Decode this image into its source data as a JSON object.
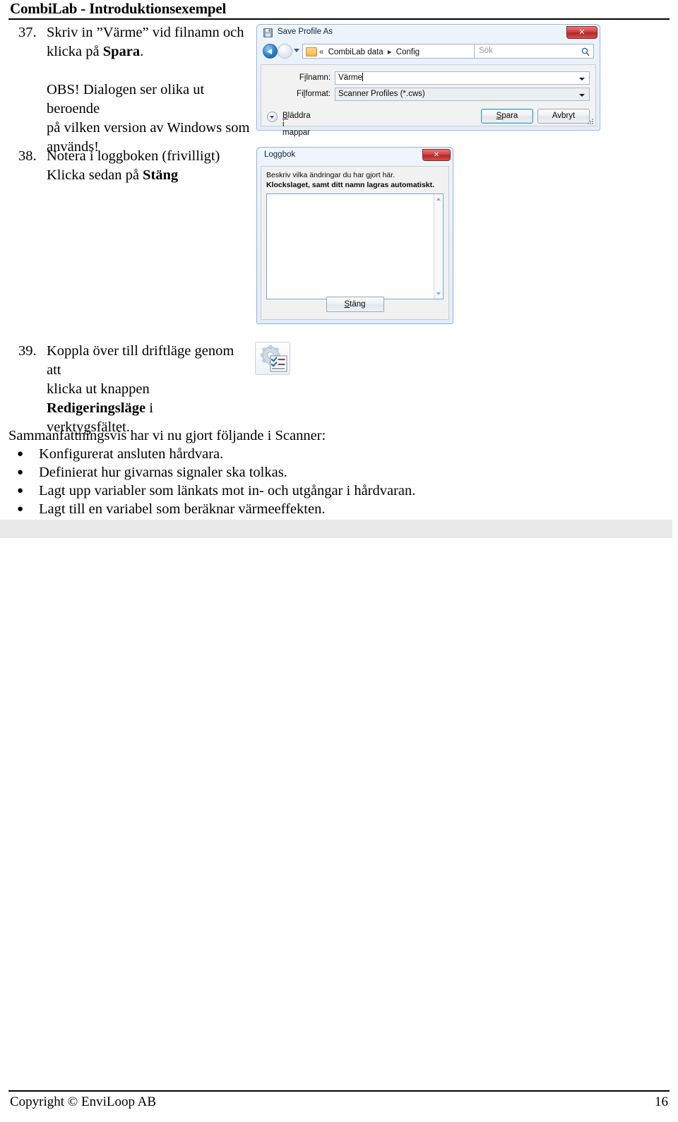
{
  "header": {
    "title": "CombiLab - Introduktionsexempel"
  },
  "steps": [
    {
      "number": "37.",
      "line1_a": "Skriv in ”Värme” vid filnamn och",
      "line2_a": "klicka på ",
      "line2_bold": "Spara",
      "line2_b": ".",
      "note1": "OBS! Dialogen ser olika ut beroende",
      "note2": "på vilken version av Windows som",
      "note3": "används!"
    },
    {
      "number": "38.",
      "line1": "Notera i loggboken (frivilligt)",
      "line2_a": "Klicka sedan på ",
      "line2_bold": "Stäng"
    },
    {
      "number": "39.",
      "line1": "Koppla över till driftläge genom att",
      "line2_a": "klicka ut knappen ",
      "line2_bold": "Redigeringsläge",
      "line2_b": " i",
      "line3": "verktygsfältet."
    }
  ],
  "summary": {
    "intro": "Sammanfattningsvis har vi nu gjort följande i Scanner:",
    "bullet_glyph": "●",
    "items": [
      "Konfigurerat ansluten hårdvara.",
      "Definierat hur givarnas signaler ska tolkas.",
      "Lagt upp variabler som länkats mot in- och utgångar i hårdvaran.",
      "Lagt till en variabel som beräknar värmeeffekten."
    ]
  },
  "save_dialog": {
    "title": "Save Profile As",
    "title_icon": "save-disk-icon",
    "close_label": "✕",
    "nav": {
      "back_icon": "back-arrow-icon",
      "forward_icon": "forward-arrow-icon",
      "recent_icon": "chevron-down-icon",
      "folder_icon": "folder-icon",
      "crumb_prefix": "«",
      "crumb1": "CombiLab data",
      "crumb_sep": "▸",
      "crumb2": "Config",
      "refresh_icon": "refresh-icon",
      "search_placeholder": "Sök",
      "search_icon": "search-icon"
    },
    "filename_label": "Filnamn:",
    "filename_value": "Värme",
    "filetype_label": "Filformat:",
    "filetype_value": "Scanner Profiles (*.cws)",
    "browse_label": "Bläddra i mappar",
    "save_button": "Spara",
    "cancel_button": "Avbryt"
  },
  "log_dialog": {
    "title": "Loggbok",
    "close_label": "✕",
    "hint_line1": "Beskriv vilka ändringar du har gjort här.",
    "hint_line2": "Klockslaget, samt ditt namn lagras automatiskt.",
    "textarea_value": "",
    "close_button": "Stäng"
  },
  "edit_mode_icon": {
    "name": "edit-mode-gear-checklist-icon"
  },
  "footer": {
    "copyright": "Copyright © EnviLoop AB",
    "page_number": "16"
  },
  "colors": {
    "band": "#e8e8e8",
    "dialog_border": "#8fb4d9",
    "close_red": "#cf3a3a",
    "accent_blue": "#3c9ad4"
  }
}
